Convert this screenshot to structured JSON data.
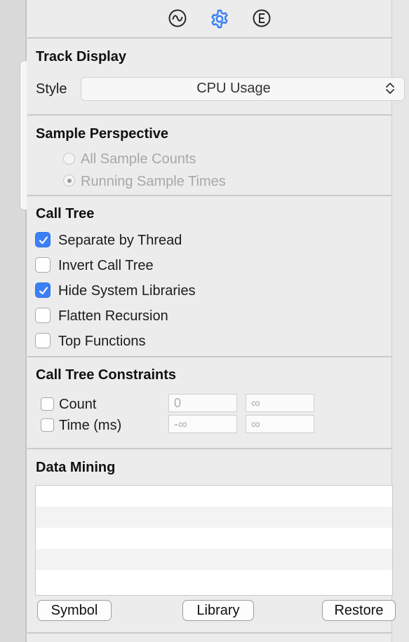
{
  "toolbar": {
    "icons": [
      "waveform-icon",
      "gear-icon",
      "extended-detail-icon"
    ],
    "active": "gear-icon",
    "accent": "#3b7ff6"
  },
  "track_display": {
    "title": "Track Display",
    "style_label": "Style",
    "style_value": "CPU Usage"
  },
  "sample_perspective": {
    "title": "Sample Perspective",
    "options": [
      "All Sample Counts",
      "Running Sample Times"
    ],
    "selected": "Running Sample Times",
    "enabled": false
  },
  "call_tree": {
    "title": "Call Tree",
    "options": [
      {
        "label": "Separate by Thread",
        "checked": true
      },
      {
        "label": "Invert Call Tree",
        "checked": false
      },
      {
        "label": "Hide System Libraries",
        "checked": true
      },
      {
        "label": "Flatten Recursion",
        "checked": false
      },
      {
        "label": "Top Functions",
        "checked": false
      }
    ]
  },
  "constraints": {
    "title": "Call Tree Constraints",
    "rows": [
      {
        "label": "Count",
        "checked": false,
        "min": "0",
        "max": "∞"
      },
      {
        "label": "Time (ms)",
        "checked": false,
        "min": "-∞",
        "max": "∞"
      }
    ]
  },
  "data_mining": {
    "title": "Data Mining",
    "buttons": {
      "symbol": "Symbol",
      "library": "Library",
      "restore": "Restore"
    }
  }
}
